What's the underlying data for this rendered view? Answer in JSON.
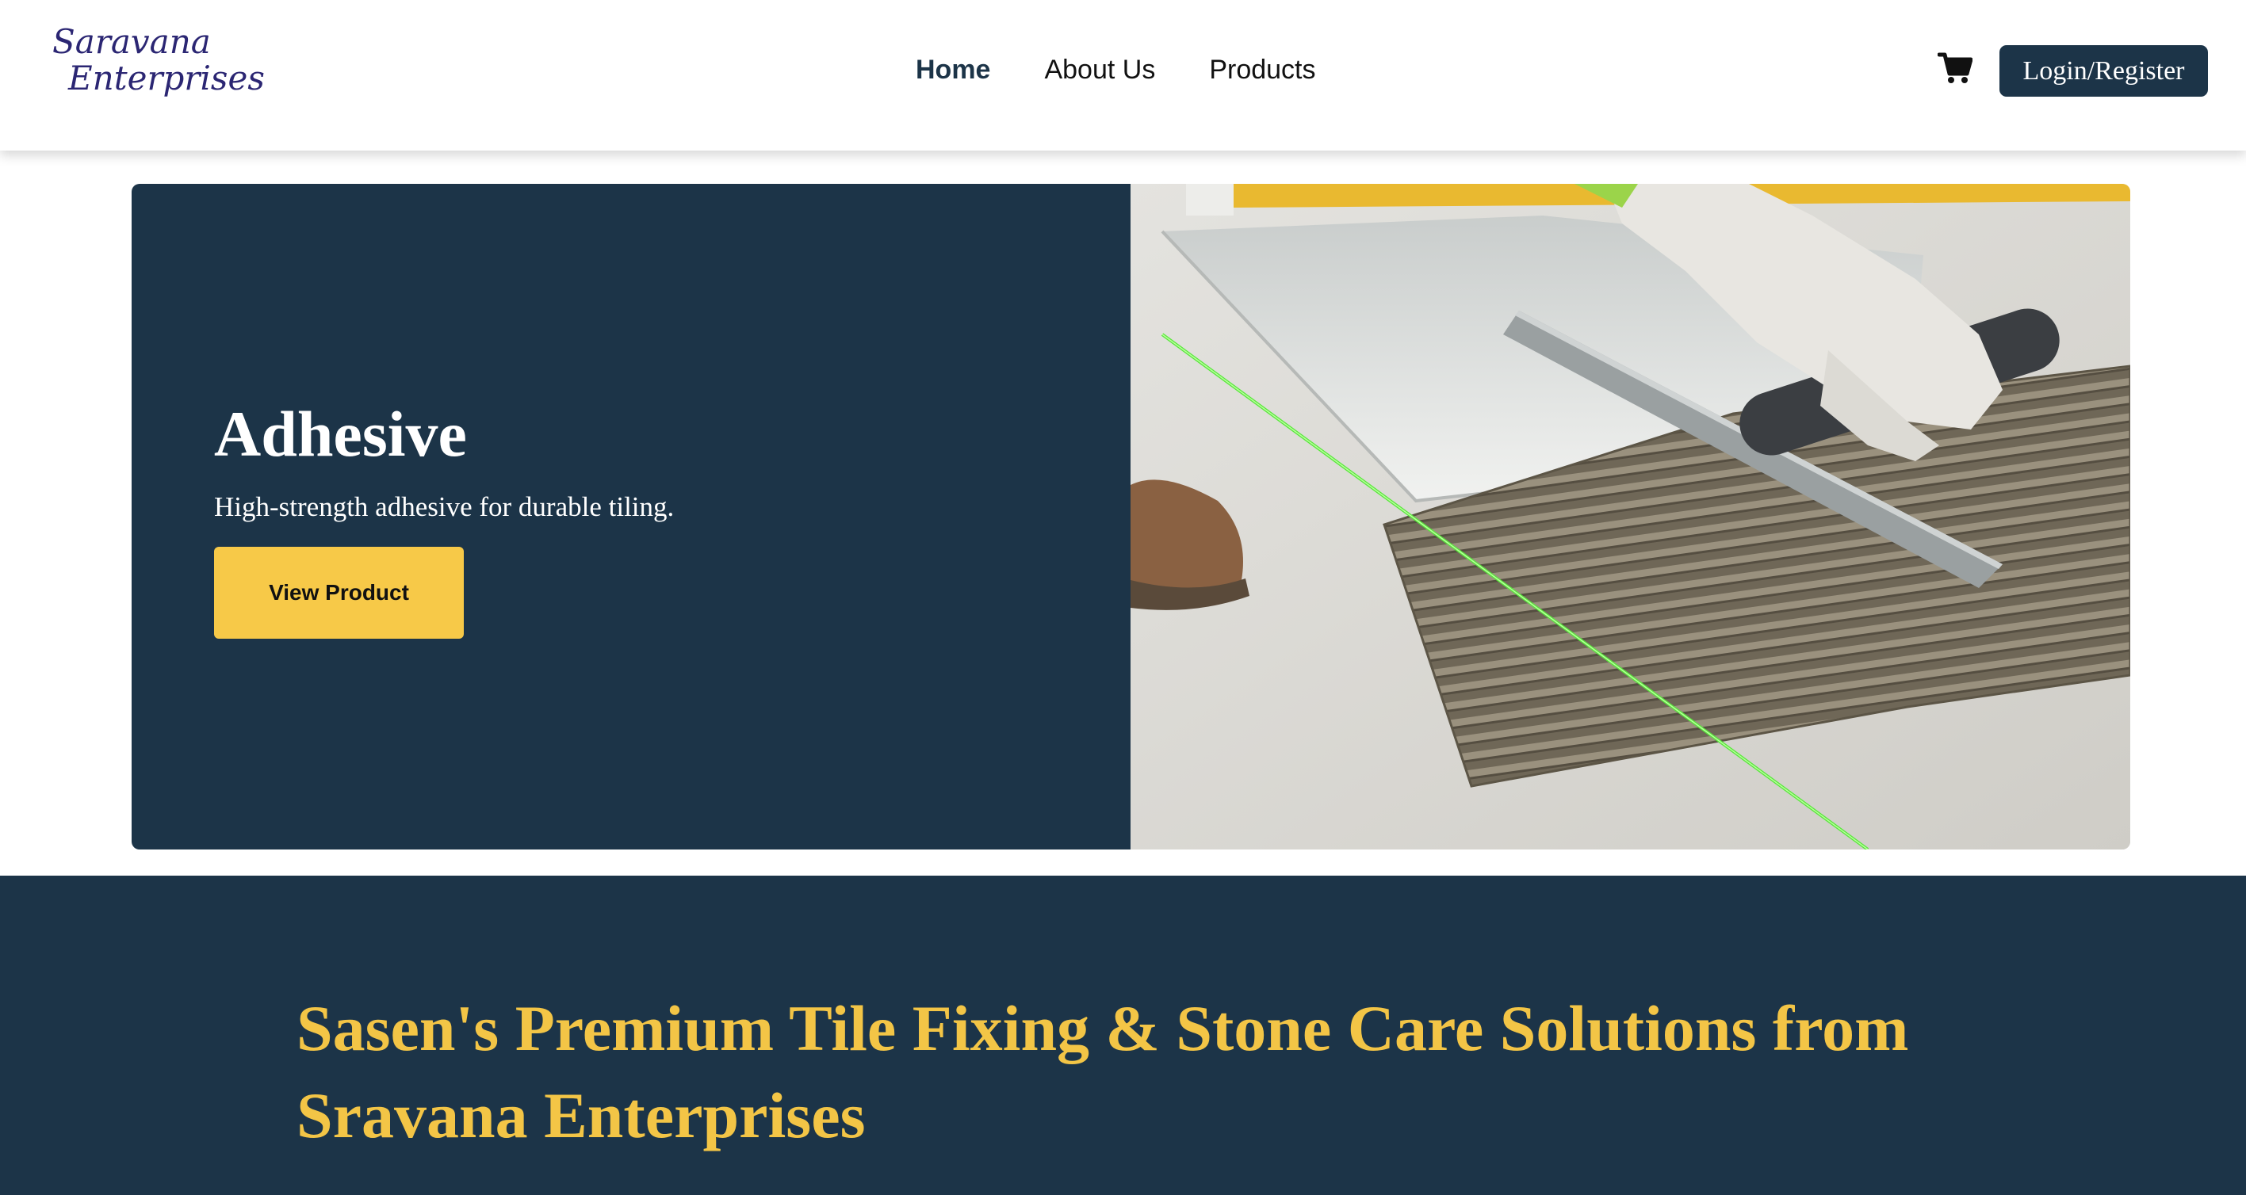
{
  "header": {
    "logo_line1": "Saravana",
    "logo_line2": "Enterprises",
    "nav": [
      {
        "label": "Home",
        "active": true
      },
      {
        "label": "About Us",
        "active": false
      },
      {
        "label": "Products",
        "active": false
      }
    ],
    "cart_icon": "shopping-cart-icon",
    "login_label": "Login/Register"
  },
  "hero": {
    "title": "Adhesive",
    "description": "High-strength adhesive for durable tiling.",
    "button_label": "View Product",
    "image": "tile-adhesive-trowel-photo"
  },
  "banner": {
    "title": "Sasen's Premium Tile Fixing & Stone Care Solutions from Sravana Enterprises"
  },
  "colors": {
    "primary_navy": "#1c3448",
    "accent_yellow": "#f7c948",
    "banner_text": "#f3c546",
    "logo": "#2b2673"
  }
}
